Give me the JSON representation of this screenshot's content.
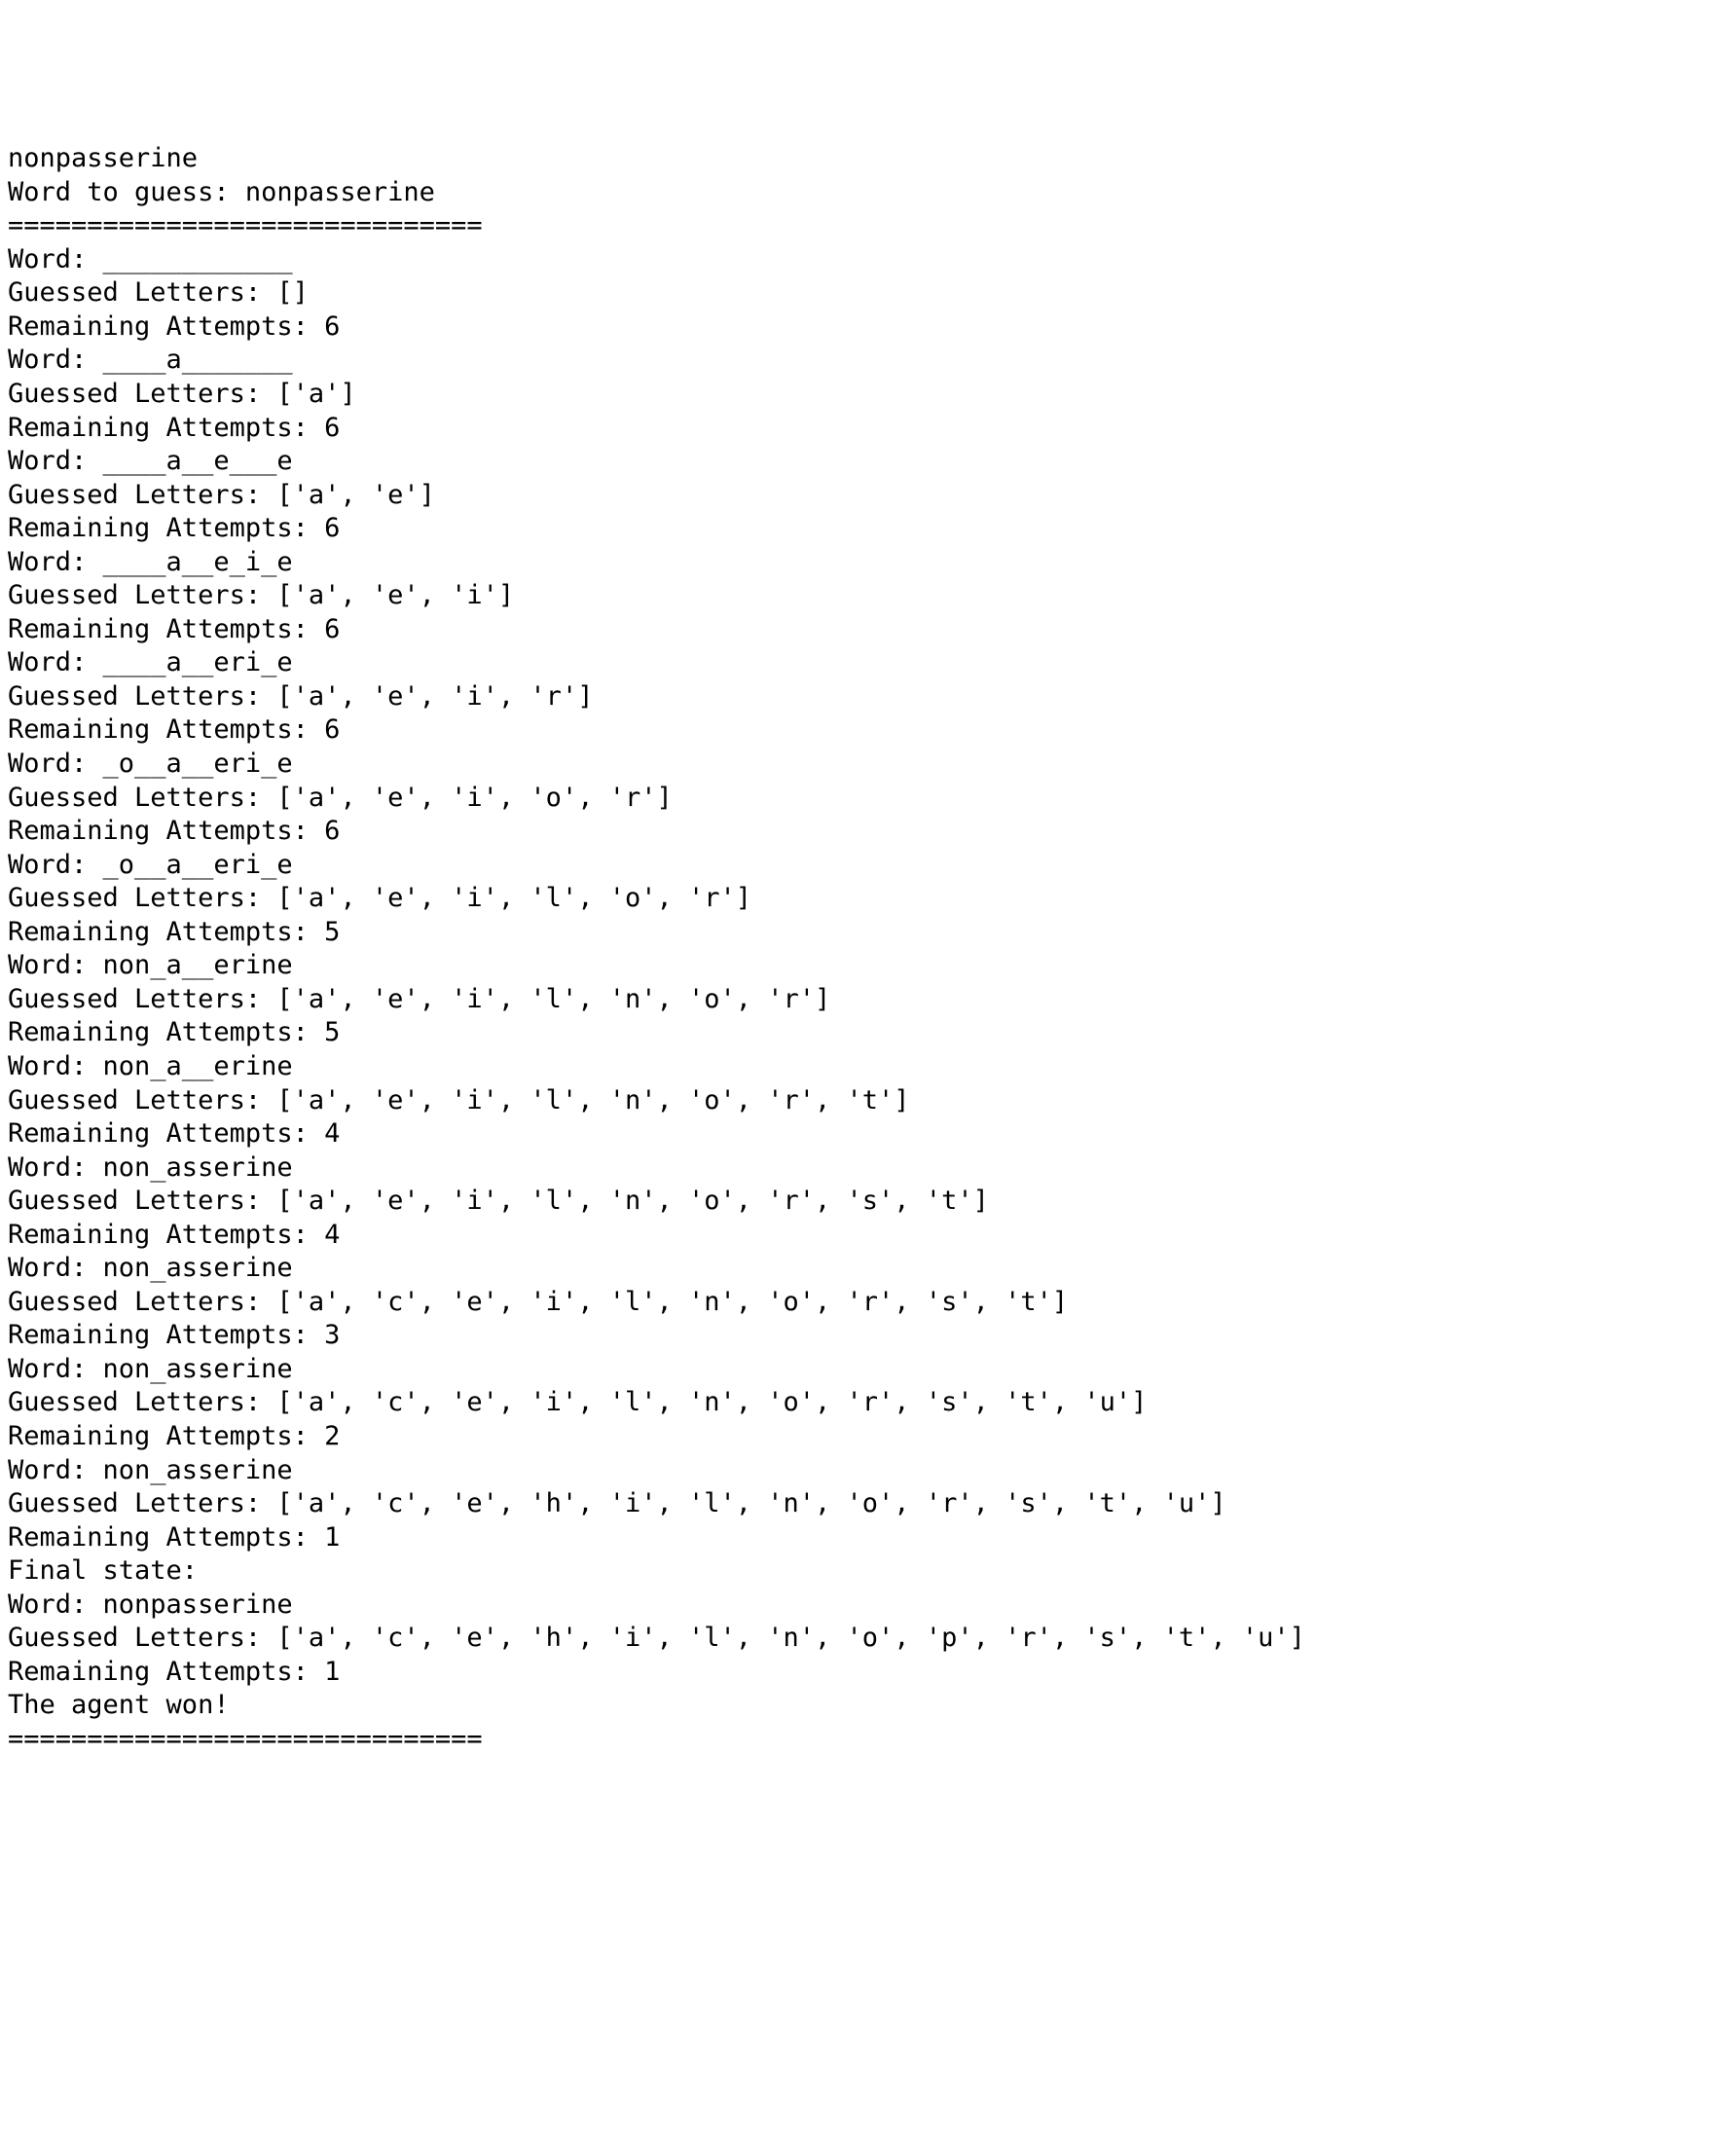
{
  "header": {
    "secret_word": "nonpasserine",
    "prompt_label": "Word to guess: ",
    "prompt_value": "nonpasserine",
    "divider": "=============================="
  },
  "labels": {
    "word": "Word: ",
    "guessed": "Guessed Letters: ",
    "remaining": "Remaining Attempts: "
  },
  "steps": [
    {
      "word": "____________",
      "guessed": "[]",
      "remaining": "6"
    },
    {
      "word": "____a_______",
      "guessed": "['a']",
      "remaining": "6"
    },
    {
      "word": "____a__e___e",
      "guessed": "['a', 'e']",
      "remaining": "6"
    },
    {
      "word": "____a__e_i_e",
      "guessed": "['a', 'e', 'i']",
      "remaining": "6"
    },
    {
      "word": "____a__eri_e",
      "guessed": "['a', 'e', 'i', 'r']",
      "remaining": "6"
    },
    {
      "word": "_o__a__eri_e",
      "guessed": "['a', 'e', 'i', 'o', 'r']",
      "remaining": "6"
    },
    {
      "word": "_o__a__eri_e",
      "guessed": "['a', 'e', 'i', 'l', 'o', 'r']",
      "remaining": "5"
    },
    {
      "word": "non_a__erine",
      "guessed": "['a', 'e', 'i', 'l', 'n', 'o', 'r']",
      "remaining": "5"
    },
    {
      "word": "non_a__erine",
      "guessed": "['a', 'e', 'i', 'l', 'n', 'o', 'r', 't']",
      "remaining": "4"
    },
    {
      "word": "non_asserine",
      "guessed": "['a', 'e', 'i', 'l', 'n', 'o', 'r', 's', 't']",
      "remaining": "4"
    },
    {
      "word": "non_asserine",
      "guessed": "['a', 'c', 'e', 'i', 'l', 'n', 'o', 'r', 's', 't']",
      "remaining": "3"
    },
    {
      "word": "non_asserine",
      "guessed": "['a', 'c', 'e', 'i', 'l', 'n', 'o', 'r', 's', 't', 'u']",
      "remaining": "2"
    },
    {
      "word": "non_asserine",
      "guessed": "['a', 'c', 'e', 'h', 'i', 'l', 'n', 'o', 'r', 's', 't', 'u']",
      "remaining": "1"
    }
  ],
  "final": {
    "heading": "Final state:",
    "word": "nonpasserine",
    "guessed": "['a', 'c', 'e', 'h', 'i', 'l', 'n', 'o', 'p', 'r', 's', 't', 'u']",
    "remaining": "1"
  },
  "footer": {
    "result": "The agent won!",
    "divider": "=============================="
  }
}
